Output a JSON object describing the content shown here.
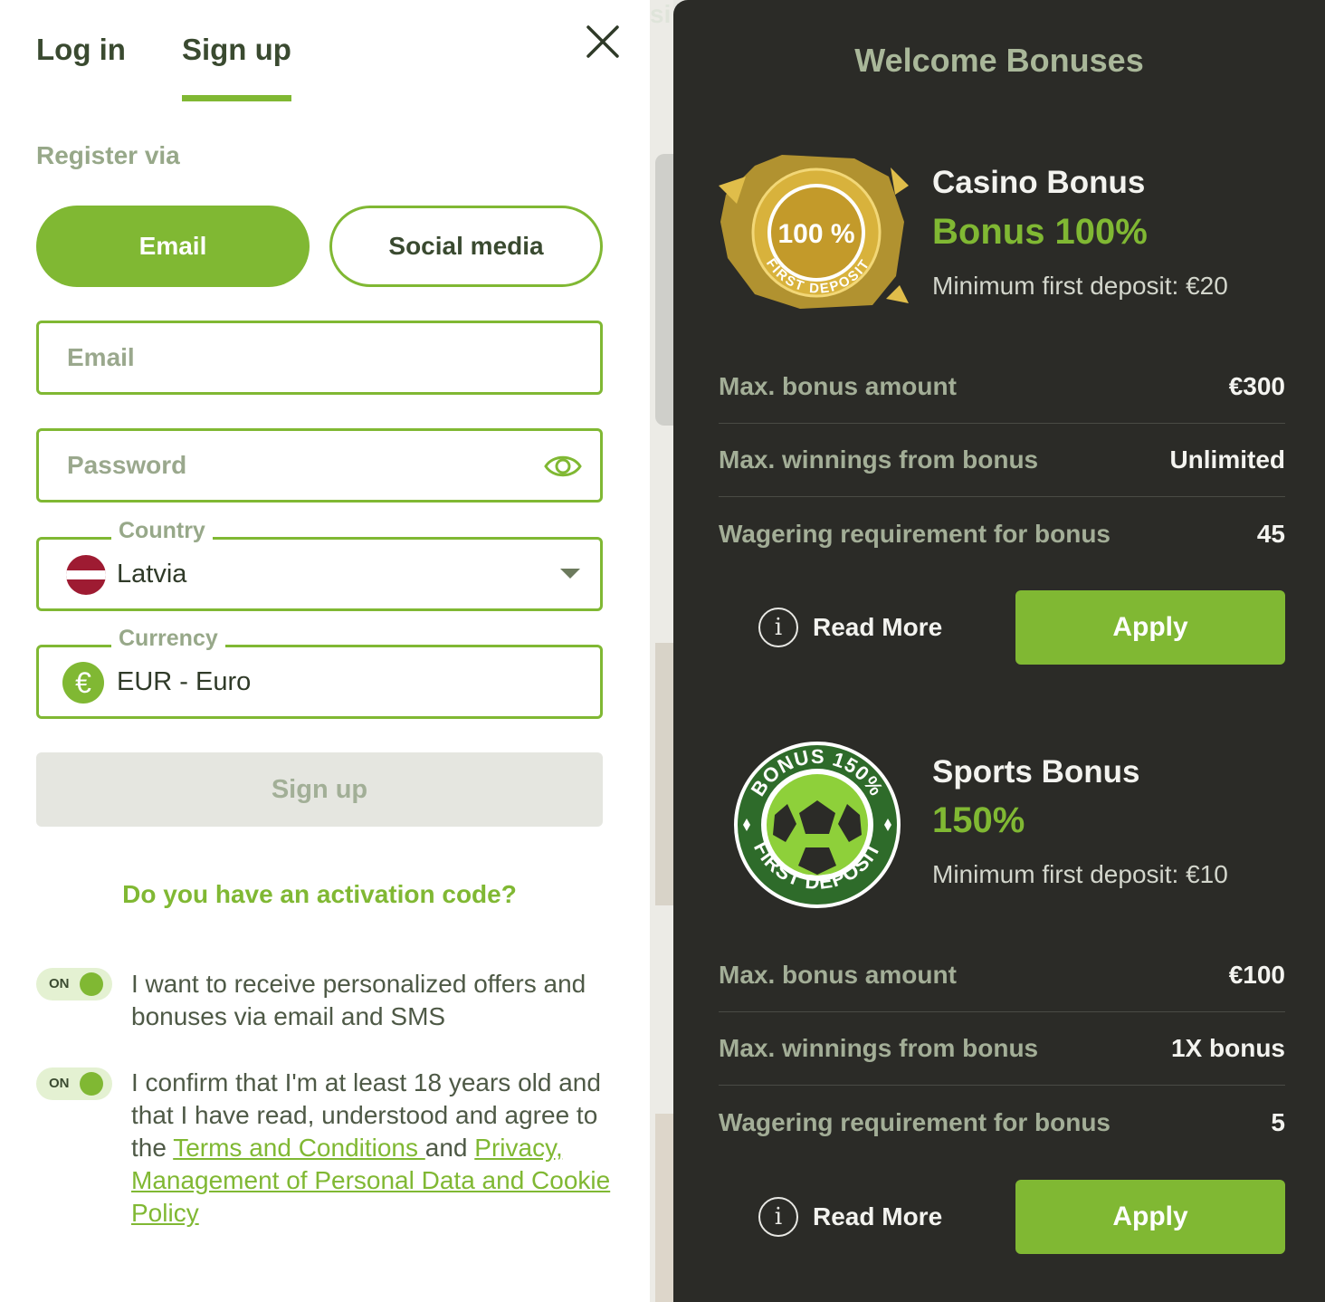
{
  "tabs": {
    "login": "Log in",
    "signup": "Sign up"
  },
  "register_via": "Register via",
  "register_options": {
    "email": "Email",
    "social": "Social media"
  },
  "form": {
    "email_placeholder": "Email",
    "password_placeholder": "Password",
    "country_label": "Country",
    "country_value": "Latvia",
    "currency_label": "Currency",
    "currency_symbol": "€",
    "currency_value": "EUR - Euro",
    "submit": "Sign up"
  },
  "activation_link": "Do you have an activation code?",
  "consents": [
    {
      "toggle": "ON",
      "text": "I want to receive personalized offers and bonuses via email and SMS"
    },
    {
      "toggle": "ON",
      "text_before": "I confirm that I'm at least 18 years old and that I have read, understood and agree to the ",
      "link1": "Terms and Conditions ",
      "text_mid": "and ",
      "link2": "Privacy, Management of Personal Data and Cookie Policy"
    }
  ],
  "background_peek": "si",
  "bonuses": {
    "title": "Welcome Bonuses",
    "casino": {
      "badge_pct": "100 %",
      "badge_text": "FIRST DEPOSIT",
      "name": "Casino Bonus",
      "pct": "Bonus 100%",
      "min_deposit": "Minimum first deposit: €20",
      "rows": [
        {
          "k": "Max. bonus amount",
          "v": "€300"
        },
        {
          "k": "Max. winnings from bonus",
          "v": "Unlimited"
        },
        {
          "k": "Wagering requirement for bonus",
          "v": "45"
        }
      ],
      "read_more": "Read More",
      "apply": "Apply"
    },
    "sports": {
      "badge_top": "BONUS 150%",
      "badge_bottom": "FIRST DEPOSIT",
      "name": "Sports Bonus",
      "pct": "150%",
      "min_deposit": "Minimum first deposit: €10",
      "rows": [
        {
          "k": "Max. bonus amount",
          "v": "€100"
        },
        {
          "k": "Max. winnings from bonus",
          "v": "1X bonus"
        },
        {
          "k": "Wagering requirement for bonus",
          "v": "5"
        }
      ],
      "read_more": "Read More",
      "apply": "Apply"
    }
  },
  "colors": {
    "accent": "#80b833",
    "dark_panel": "#2b2b27",
    "muted_green": "#97a889"
  },
  "icons": [
    "close-icon",
    "eye-icon",
    "latvia-flag-icon",
    "euro-icon",
    "caret-down-icon",
    "info-icon",
    "soccer-ball-icon"
  ]
}
